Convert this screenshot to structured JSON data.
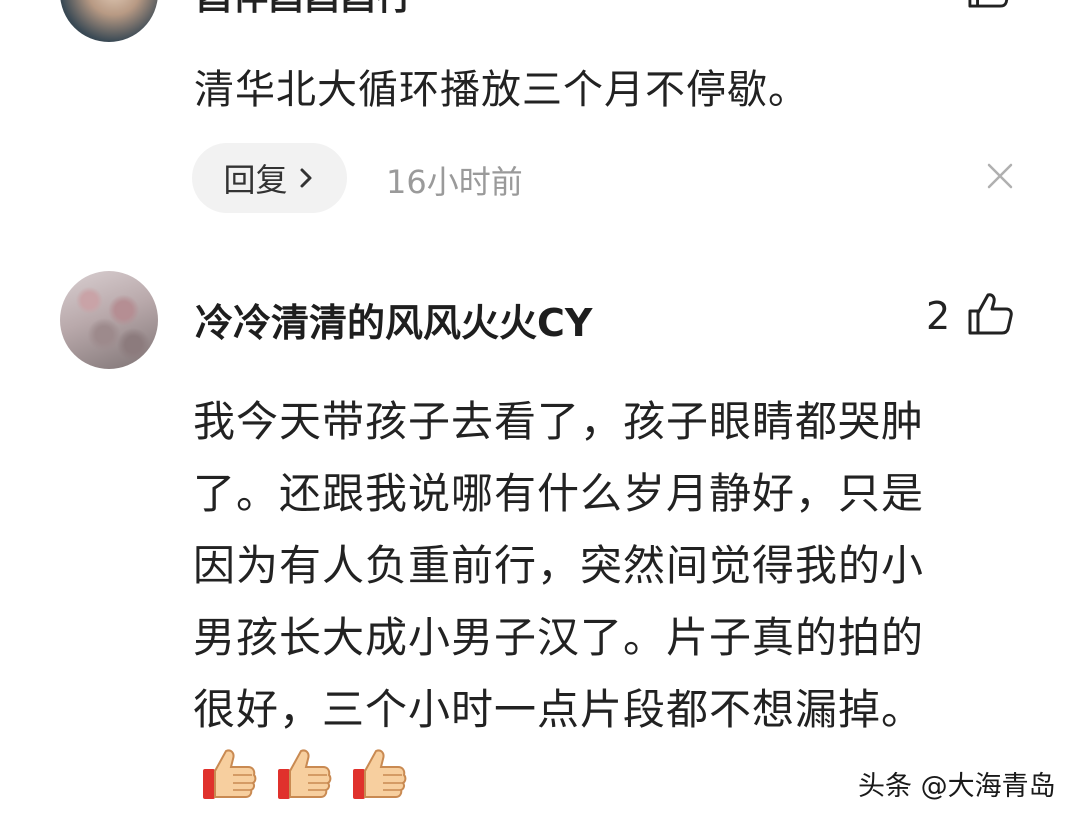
{
  "comment1": {
    "username": "酉伴酉酉酉行",
    "like_count": "",
    "text": "清华北大循环播放三个月不停歇。",
    "reply_label": "回复",
    "time": "16小时前"
  },
  "comment2": {
    "username": "冷冷清清的风风火火CY",
    "like_count": "2",
    "text_lines": [
      "我今天带孩子去看了，孩子眼睛都哭肿",
      "了。还跟我说哪有什么岁月静好，只是",
      "因为有人负重前行，突然间觉得我的小",
      "男孩长大成小男子汉了。片子真的拍的",
      "很好，三个小时一点片段都不想漏掉。"
    ],
    "emojis": [
      "thumbs-up",
      "thumbs-up",
      "thumbs-up"
    ]
  },
  "watermark": "头条 @大海青岛",
  "colors": {
    "text": "#222222",
    "muted": "#9a9a9a",
    "reply_bg": "#f2f2f2"
  }
}
